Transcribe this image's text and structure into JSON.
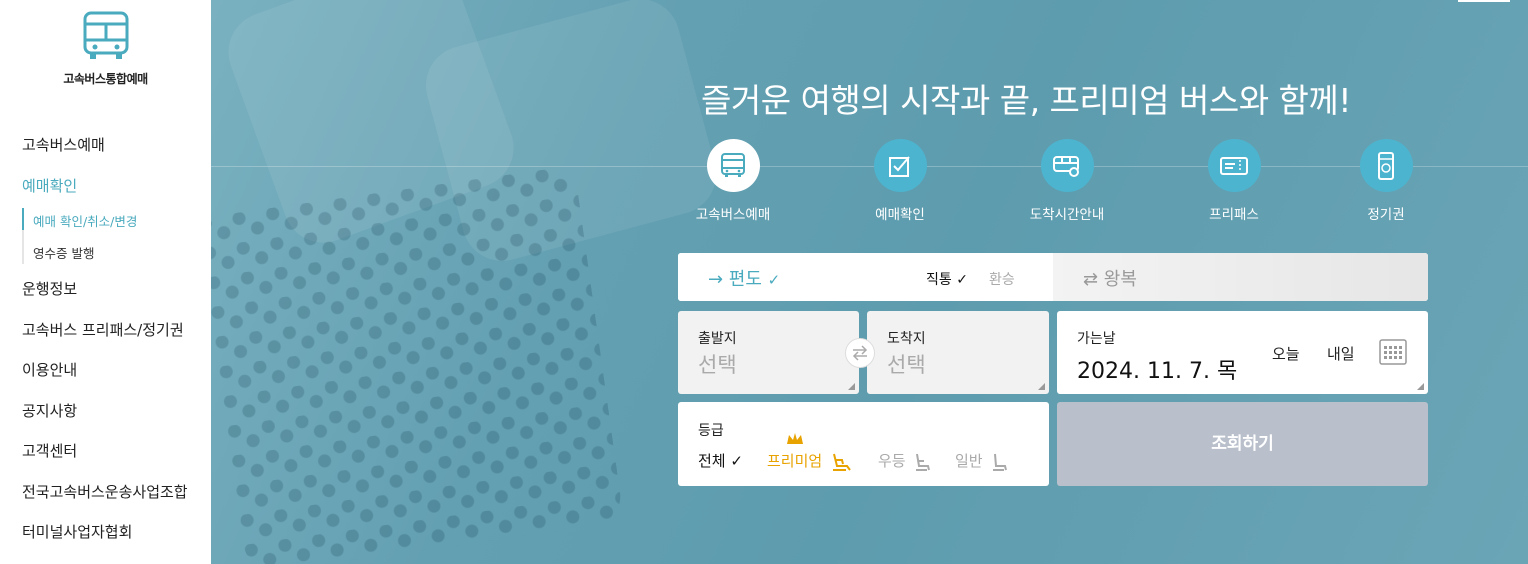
{
  "logo": {
    "text": "고속버스통합예매",
    "icon": "bus-icon"
  },
  "sidebar": {
    "items": [
      {
        "label": "고속버스예매"
      },
      {
        "label": "예매확인"
      },
      {
        "label": "운행정보"
      },
      {
        "label": "고속버스 프리패스/정기권"
      },
      {
        "label": "이용안내"
      },
      {
        "label": "공지사항"
      },
      {
        "label": "고객센터"
      },
      {
        "label": "전국고속버스운송사업조합"
      },
      {
        "label": "터미널사업자협회"
      }
    ],
    "subitems": [
      {
        "label": "예매 확인/취소/변경"
      },
      {
        "label": "영수증 발행"
      }
    ]
  },
  "hero": {
    "title": "즐거운 여행의 시작과 끝, 프리미엄 버스와 함께!",
    "nav": [
      {
        "label": "고속버스예매",
        "icon": "bus-icon"
      },
      {
        "label": "예매확인",
        "icon": "checkbox-icon"
      },
      {
        "label": "도착시간안내",
        "icon": "bus-time-icon"
      },
      {
        "label": "프리패스",
        "icon": "ticket-icon"
      },
      {
        "label": "정기권",
        "icon": "pass-icon"
      }
    ]
  },
  "trip": {
    "oneway": "→ 편도",
    "oneway_check": "✓",
    "direct": "직통 ✓",
    "transfer": "환승",
    "roundtrip": "⇄ 왕복"
  },
  "form": {
    "departure_label": "출발지",
    "departure_value": "선택",
    "arrival_label": "도착지",
    "arrival_value": "선택",
    "date_label": "가는날",
    "date_value": "2024. 11. 7. 목",
    "today": "오늘",
    "tomorrow": "내일",
    "grade_label": "등급",
    "grade_all": "전체 ✓",
    "grade_premium": "프리미엄",
    "grade_woodeung": "우등",
    "grade_general": "일반",
    "search_button": "조회하기"
  },
  "colors": {
    "accent": "#4aaabe",
    "icon_circle": "#4db4cf",
    "premium": "#e8a300",
    "search_button": "#b9c0cc"
  }
}
